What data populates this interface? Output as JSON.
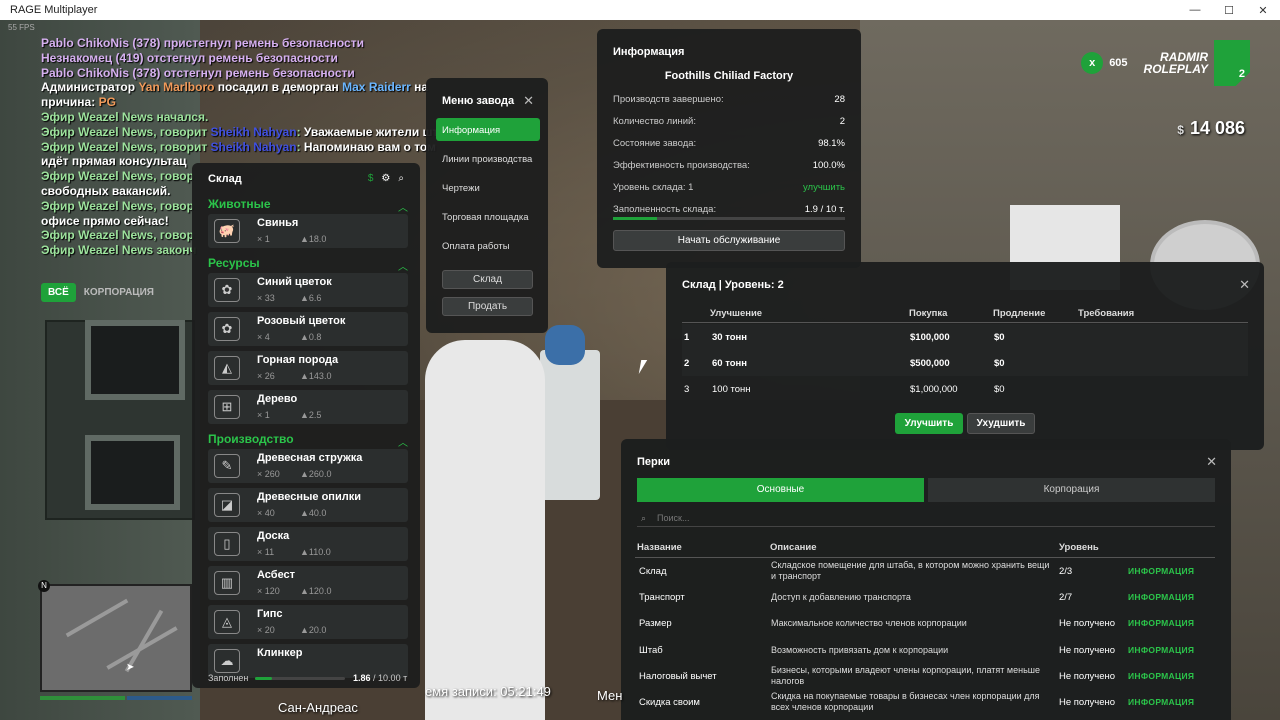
{
  "window": {
    "title": "RAGE Multiplayer"
  },
  "fps": "55 FPS",
  "chat": [
    {
      "cls": "c-p",
      "parts": [
        {
          "t": "Pablo ChikoNis (378) пристегнул ремень безопасности",
          "c": ""
        }
      ]
    },
    {
      "cls": "c-p",
      "parts": [
        {
          "t": "Незнакомец (419) отстегнул ремень безопасности",
          "c": ""
        }
      ]
    },
    {
      "cls": "c-p",
      "parts": [
        {
          "t": "Pablo ChikoNis (378) отстегнул ремень безопасности",
          "c": ""
        }
      ]
    },
    {
      "cls": "c-w",
      "parts": [
        {
          "t": "Администратор ",
          "c": ""
        },
        {
          "t": "Yan Marlboro",
          "c": "c-o"
        },
        {
          "t": " посадил в деморган ",
          "c": ""
        },
        {
          "t": "Max Raiderr",
          "c": "c-b"
        },
        {
          "t": " на",
          "c": ""
        }
      ]
    },
    {
      "cls": "c-w",
      "parts": [
        {
          "t": "причина: ",
          "c": ""
        },
        {
          "t": "PG",
          "c": "c-o"
        }
      ]
    },
    {
      "cls": "c-g",
      "parts": [
        {
          "t": "Эфир Weazel News начался.",
          "c": ""
        }
      ]
    },
    {
      "cls": "c-g",
      "parts": [
        {
          "t": "Эфир Weazel News, говорит ",
          "c": ""
        },
        {
          "t": "Sheikh Nahyan",
          "c": "c-d"
        },
        {
          "t": ": ",
          "c": ""
        },
        {
          "t": "Уважаемые жители шт",
          "c": "c-w"
        }
      ]
    },
    {
      "cls": "c-g",
      "parts": [
        {
          "t": "Эфир Weazel News, говорит ",
          "c": ""
        },
        {
          "t": "Sheikh Nahyan",
          "c": "c-d"
        },
        {
          "t": ": ",
          "c": ""
        },
        {
          "t": "Напоминаю вам о том",
          "c": "c-w"
        }
      ]
    },
    {
      "cls": "c-w",
      "parts": [
        {
          "t": "идёт прямая консультац",
          "c": ""
        }
      ]
    },
    {
      "cls": "c-g",
      "parts": [
        {
          "t": "Эфир Weazel News, говор",
          "c": ""
        }
      ]
    },
    {
      "cls": "c-w",
      "parts": [
        {
          "t": "свободных вакансий.",
          "c": ""
        }
      ]
    },
    {
      "cls": "c-g",
      "parts": [
        {
          "t": "Эфир Weazel News, говор",
          "c": ""
        }
      ]
    },
    {
      "cls": "c-w",
      "parts": [
        {
          "t": "офисе прямо сейчас!",
          "c": ""
        }
      ]
    },
    {
      "cls": "c-g",
      "parts": [
        {
          "t": "Эфир Weazel News, говор",
          "c": ""
        }
      ]
    },
    {
      "cls": "c-g",
      "parts": [
        {
          "t": "Эфир Weazel News законч",
          "c": ""
        }
      ]
    }
  ],
  "chat_tabs": {
    "all": "ВСЁ",
    "corp": "КОРПОРАЦИЯ"
  },
  "hud": {
    "xbox": "x",
    "online": "605",
    "logo_line1": "RADMIR",
    "logo_line2": "ROLEPLAY",
    "server": "2",
    "currency": "$",
    "money": "14 086"
  },
  "sklad": {
    "title": "Склад",
    "sections": [
      {
        "name": "Животные",
        "items": [
          {
            "name": "Свинья",
            "qty": "× 1",
            "w": "18.0",
            "icon": "pig-icon",
            "glyph": "🐖"
          }
        ]
      },
      {
        "name": "Ресурсы",
        "items": [
          {
            "name": "Синий цветок",
            "qty": "× 33",
            "w": "6.6",
            "icon": "flower-icon",
            "glyph": "✿"
          },
          {
            "name": "Розовый цветок",
            "qty": "× 4",
            "w": "0.8",
            "icon": "flower-icon",
            "glyph": "✿"
          },
          {
            "name": "Горная порода",
            "qty": "× 26",
            "w": "143.0",
            "icon": "rock-icon",
            "glyph": "◭"
          },
          {
            "name": "Дерево",
            "qty": "× 1",
            "w": "2.5",
            "icon": "wood-icon",
            "glyph": "⊞"
          }
        ]
      },
      {
        "name": "Производство",
        "items": [
          {
            "name": "Древесная стружка",
            "qty": "× 260",
            "w": "260.0",
            "icon": "shavings-icon",
            "glyph": "✎"
          },
          {
            "name": "Древесные опилки",
            "qty": "× 40",
            "w": "40.0",
            "icon": "sawdust-icon",
            "glyph": "◪"
          },
          {
            "name": "Доска",
            "qty": "× 11",
            "w": "110.0",
            "icon": "plank-icon",
            "glyph": "▯"
          },
          {
            "name": "Асбест",
            "qty": "× 120",
            "w": "120.0",
            "icon": "asbestos-icon",
            "glyph": "▥"
          },
          {
            "name": "Гипс",
            "qty": "× 20",
            "w": "20.0",
            "icon": "gypsum-icon",
            "glyph": "◬"
          },
          {
            "name": "Клинкер",
            "qty": "",
            "w": "",
            "icon": "clinker-icon",
            "glyph": "☁"
          }
        ]
      }
    ],
    "fill_label": "Заполнен",
    "fill_value": "1.86",
    "fill_max": "/ 10.00 т",
    "fill_fraction": 0.186
  },
  "factory_menu": {
    "title": "Меню завода",
    "items": [
      "Информация",
      "Линии производства",
      "Чертежи",
      "Торговая площадка",
      "Оплата работы"
    ],
    "btn_sklad": "Склад",
    "btn_sell": "Продать"
  },
  "info": {
    "title": "Информация",
    "factory": "Foothills Chiliad Factory",
    "rows": [
      {
        "k": "Производств завершено:",
        "v": "28",
        "green": false
      },
      {
        "k": "Количество линий:",
        "v": "2",
        "green": false
      },
      {
        "k": "Состояние завода:",
        "v": "98.1%",
        "green": false
      },
      {
        "k": "Эффективность производства:",
        "v": "100.0%",
        "green": false
      },
      {
        "k": "Уровень склада: 1",
        "v": "улучшить",
        "green": true
      },
      {
        "k": "Заполненность склада:",
        "v": "1.9 / 10 т.",
        "green": false
      }
    ],
    "fill_fraction": 0.19,
    "service_btn": "Начать обслуживание"
  },
  "level": {
    "title": "Склад | Уровень: 2",
    "headers": [
      "Улучшение",
      "Покупка",
      "Продление",
      "Требования"
    ],
    "rows": [
      {
        "n": "1",
        "up": "30 тонн",
        "buy": "$100,000",
        "ext": "$0",
        "bold": true,
        "hl": true
      },
      {
        "n": "2",
        "up": "60 тонн",
        "buy": "$500,000",
        "ext": "$0",
        "bold": true,
        "hl": true
      },
      {
        "n": "3",
        "up": "100 тонн",
        "buy": "$1,000,000",
        "ext": "$0",
        "bold": false,
        "hl": false
      }
    ],
    "btn_up": "Улучшить",
    "btn_down": "Ухудшить"
  },
  "perks": {
    "title": "Перки",
    "tab_main": "Основные",
    "tab_corp": "Корпорация",
    "search_placeholder": "Поиск...",
    "headers": [
      "Название",
      "Описание",
      "Уровень"
    ],
    "rows": [
      {
        "n": "Склад",
        "d": "Складское помещение для штаба, в котором можно хранить вещи и транспорт",
        "l": "2/3",
        "i": "ИНФОРМАЦИЯ"
      },
      {
        "n": "Транспорт",
        "d": "Доступ к добавлению транспорта",
        "l": "2/7",
        "i": "ИНФОРМАЦИЯ"
      },
      {
        "n": "Размер",
        "d": "Максимальное количество членов корпорации",
        "l": "Не получено",
        "i": "ИНФОРМАЦИЯ"
      },
      {
        "n": "Штаб",
        "d": "Возможность привязать дом к корпорации",
        "l": "Не получено",
        "i": "ИНФОРМАЦИЯ"
      },
      {
        "n": "Налоговый вычет",
        "d": "Бизнесы, которыми владеют члены корпорации, платят меньше налогов",
        "l": "Не получено",
        "i": "ИНФОРМАЦИЯ"
      },
      {
        "n": "Скидка своим",
        "d": "Скидка на покупаемые товары в бизнесах член корпорации для всех членов корпорации",
        "l": "Не получено",
        "i": "ИНФОРМАЦИЯ"
      }
    ]
  },
  "minimap": {
    "north": "N"
  },
  "location": "Сан-Андреас",
  "record": "емя записи: 05:21:49",
  "menu_partial": "Мен",
  "colors": {
    "accent": "#1fa23a"
  }
}
